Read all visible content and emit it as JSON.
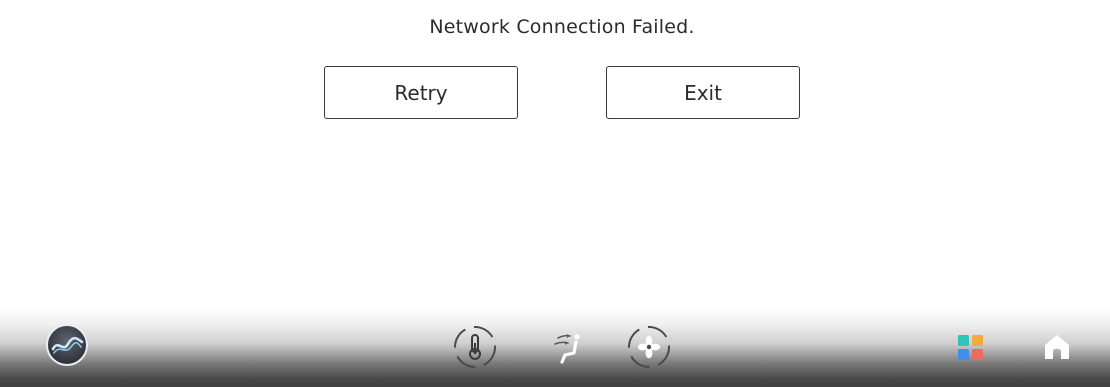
{
  "dialog": {
    "message": "Network Connection Failed.",
    "retry_label": "Retry",
    "exit_label": "Exit"
  },
  "bottom_bar": {
    "items": [
      {
        "icon": "brand-logo-icon"
      },
      {
        "icon": "thermometer-icon"
      },
      {
        "icon": "seat-airflow-icon"
      },
      {
        "icon": "fan-icon"
      },
      {
        "icon": "apps-grid-icon"
      },
      {
        "icon": "home-icon"
      }
    ]
  },
  "colors": {
    "text": "#2b2b2b",
    "button_border": "#3a3a3a",
    "app_tile_teal": "#2fc4b8",
    "app_tile_orange": "#f6a940",
    "app_tile_blue": "#3f8ee8",
    "app_tile_red": "#ef6a5a"
  }
}
